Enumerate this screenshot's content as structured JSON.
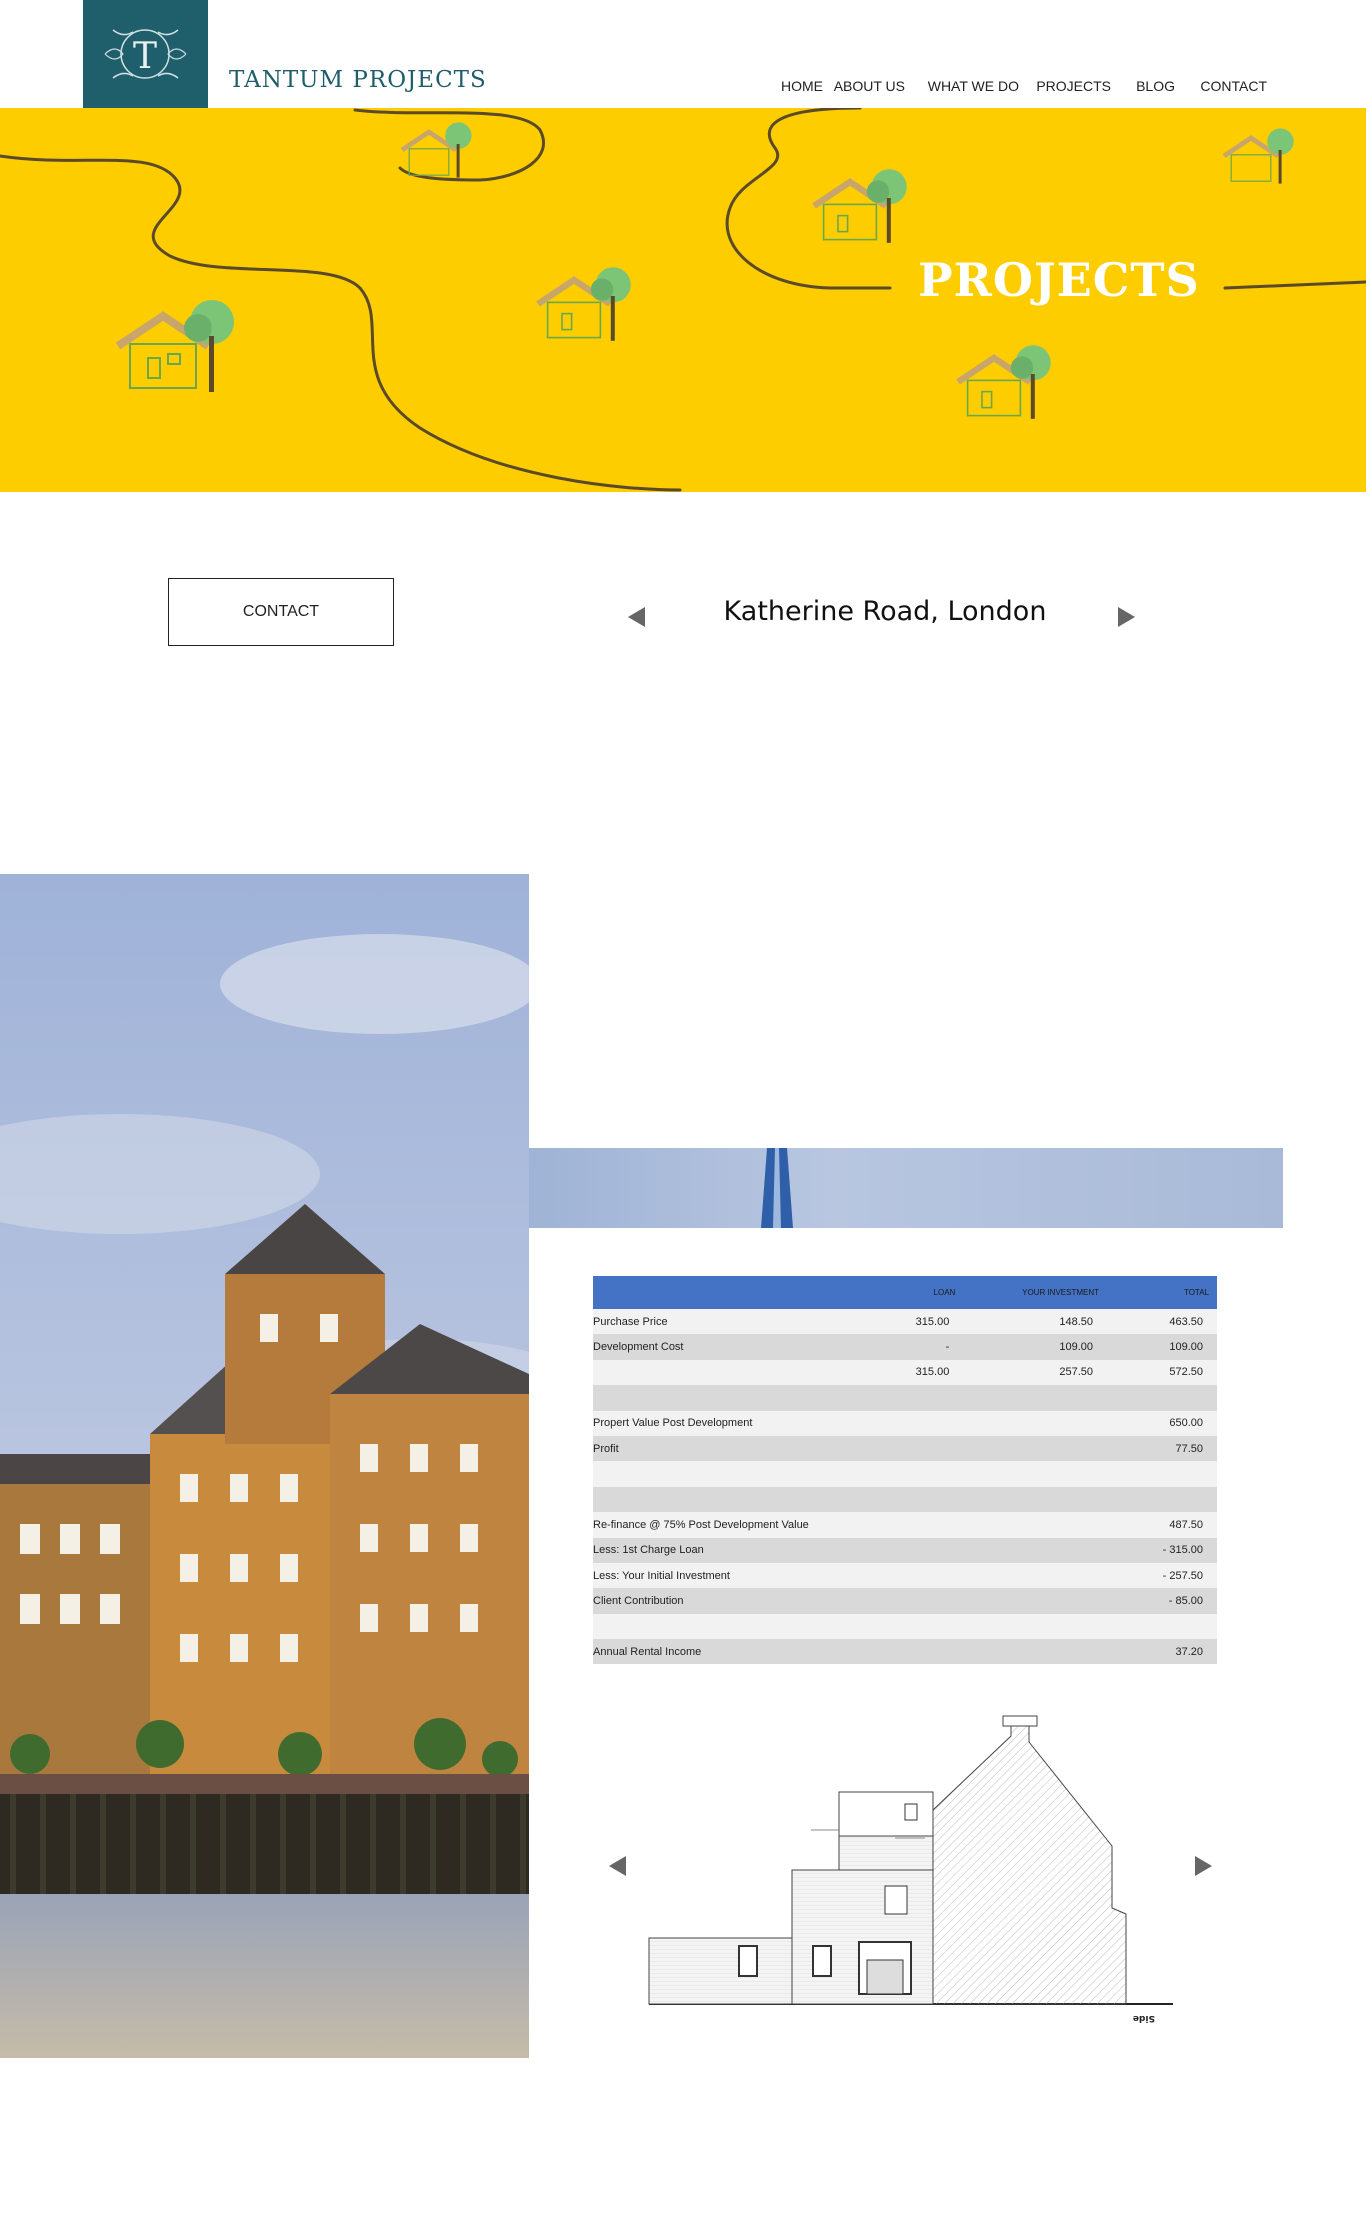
{
  "header": {
    "logo_letter": "T",
    "brand": "TANTUM PROJECTS",
    "nav": [
      "HOME",
      "ABOUT US",
      "WHAT WE DO",
      "PROJECTS",
      "BLOG",
      "CONTACT"
    ]
  },
  "hero": {
    "title": "PROJECTS",
    "background": "#fdcd00"
  },
  "contact_button": "CONTACT",
  "project": {
    "title": "Katherine Road, London"
  },
  "financials": {
    "headers": [
      "",
      "LOAN",
      "YOUR INVESTMENT",
      "TOTAL"
    ],
    "rows": [
      [
        "Purchase Price",
        "315.00",
        "148.50",
        "463.50"
      ],
      [
        "Development Cost",
        "-",
        "109.00",
        "109.00"
      ],
      [
        "",
        "315.00",
        "257.50",
        "572.50"
      ],
      [
        "",
        "",
        "",
        ""
      ],
      [
        "Propert Value Post Development",
        "",
        "",
        "650.00"
      ],
      [
        "Profit",
        "",
        "",
        "77.50"
      ],
      [
        "",
        "",
        "",
        ""
      ],
      [
        "",
        "",
        "",
        ""
      ],
      [
        "Re-finance @ 75% Post Development Value",
        "",
        "",
        "487.50"
      ],
      [
        "Less: 1st Charge Loan",
        "",
        "",
        "- 315.00"
      ],
      [
        "Less: Your Initial Investment",
        "",
        "",
        "- 257.50"
      ],
      [
        "Client Contribution",
        "",
        "",
        "-     85.00"
      ],
      [
        "",
        "",
        "",
        ""
      ],
      [
        "Annual Rental Income",
        "",
        "",
        "37.20"
      ]
    ]
  },
  "drawing": {
    "caption": "Side"
  },
  "colors": {
    "brand_teal": "#1f5e6b",
    "hero_yellow": "#fdcd00",
    "table_header": "#4472c4"
  }
}
